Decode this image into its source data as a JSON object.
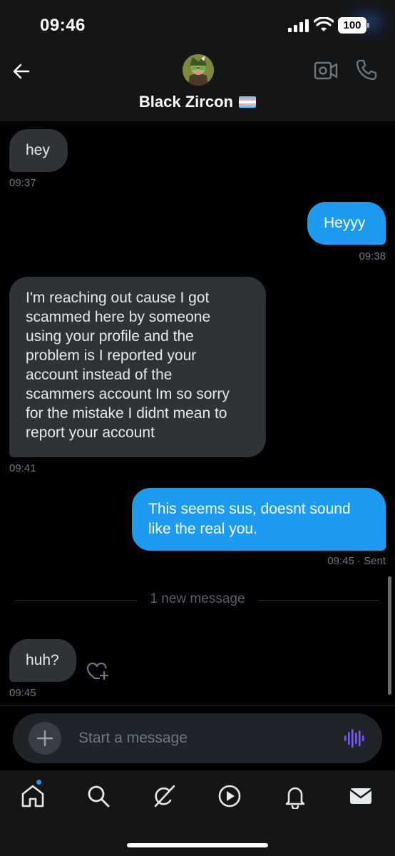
{
  "status_bar": {
    "time": "09:46",
    "battery": "100"
  },
  "header": {
    "contact_name": "Black Zircon"
  },
  "messages": [
    {
      "direction": "in",
      "text": "hey",
      "time": "09:37"
    },
    {
      "direction": "out",
      "text": "Heyyy",
      "time": "09:38"
    },
    {
      "direction": "in",
      "lines": [
        "I'm reaching out cause I got",
        "scammed here by someone",
        "using your profile and the",
        "problem is I reported your",
        "account instead of the",
        "scammers account Im so sorry",
        "for the mistake I didnt mean to",
        "report your account"
      ],
      "time": "09:41"
    },
    {
      "direction": "out",
      "lines": [
        "This seems sus, doesnt sound",
        "like the real you."
      ],
      "time": "09:45 · Sent"
    },
    {
      "direction": "in",
      "text": "huh?",
      "time": "09:45"
    }
  ],
  "divider": {
    "label": "1 new message"
  },
  "composer": {
    "placeholder": "Start a message"
  },
  "nav": {
    "items": [
      "home-icon",
      "search-icon",
      "grok-icon",
      "video-icon",
      "notifications-icon",
      "messages-icon"
    ]
  },
  "colors": {
    "accent": "#1d9bf0",
    "incoming_bubble": "#2f3336",
    "voice": "#7856ff"
  }
}
